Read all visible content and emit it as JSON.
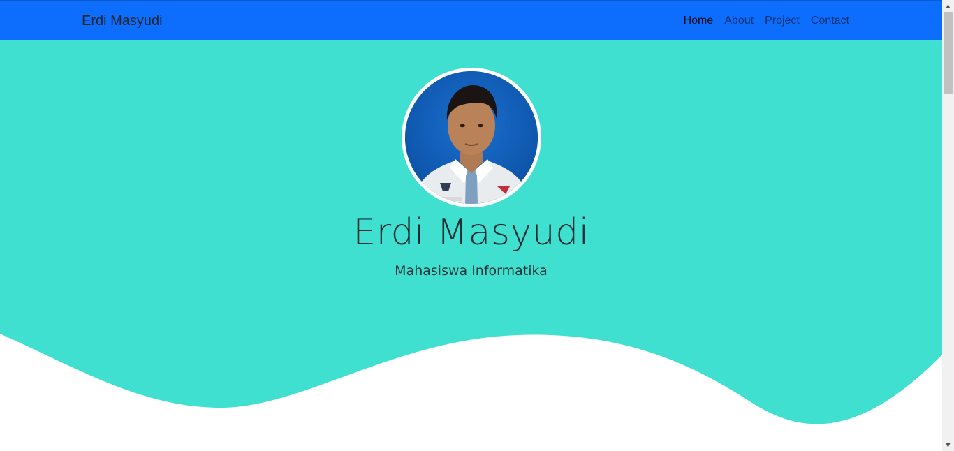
{
  "navbar": {
    "brand": "Erdi Masyudi",
    "links": [
      {
        "label": "Home",
        "active": true
      },
      {
        "label": "About",
        "active": false
      },
      {
        "label": "Project",
        "active": false
      },
      {
        "label": "Contact",
        "active": false
      }
    ]
  },
  "hero": {
    "name": "Erdi Masyudi",
    "subtitle": "Mahasiswa Informatika",
    "avatar_icon": "profile-photo"
  },
  "colors": {
    "navbar_bg": "#0d6efd",
    "hero_bg": "#40e0d0",
    "wave_fill": "#ffffff"
  },
  "scrollbar": {
    "up_icon": "▲",
    "down_icon": "▼"
  }
}
